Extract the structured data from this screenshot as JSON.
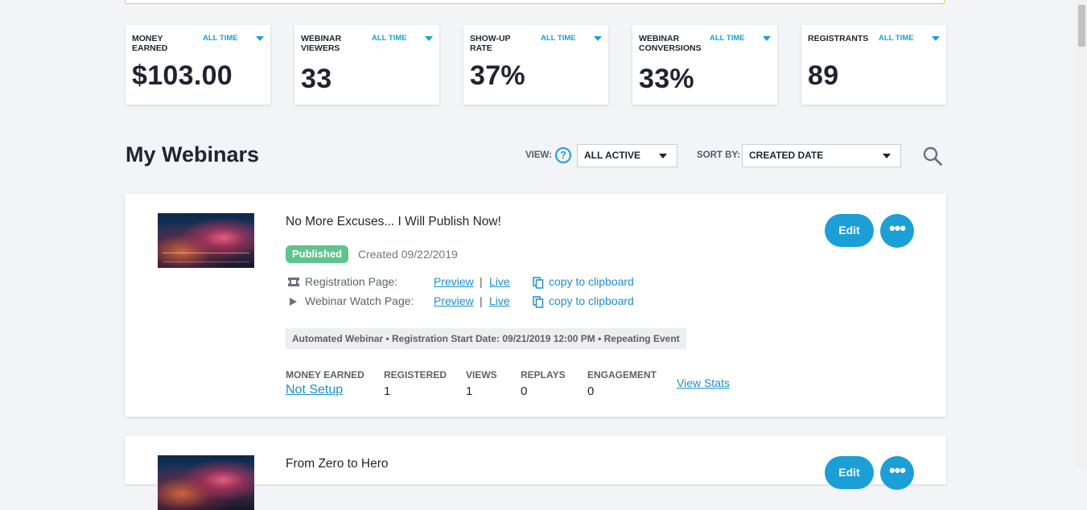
{
  "stats": [
    {
      "label": "MONEY EARNED",
      "range": "ALL TIME",
      "value": "$103.00"
    },
    {
      "label": "WEBINAR VIEWERS",
      "range": "ALL TIME",
      "value": "33"
    },
    {
      "label": "SHOW-UP RATE",
      "range": "ALL TIME",
      "value": "37%"
    },
    {
      "label": "WEBINAR CONVERSIONS",
      "range": "ALL TIME",
      "value": "33%"
    },
    {
      "label": "REGISTRANTS",
      "range": "ALL TIME",
      "value": "89"
    }
  ],
  "header": {
    "title": "My Webinars",
    "view_label": "VIEW:",
    "help_glyph": "?",
    "view_value": "ALL ACTIVE",
    "sort_label": "SORT BY:",
    "sort_value": "CREATED DATE"
  },
  "webinars": [
    {
      "title": "No More Excuses... I Will Publish Now!",
      "status": "Published",
      "created": "Created 09/22/2019",
      "registration_label": "Registration Page:",
      "watch_label": "Webinar Watch Page:",
      "preview": "Preview",
      "separator": "|",
      "live": "Live",
      "copy": "copy to clipboard",
      "meta": "Automated Webinar • Registration Start Date: 09/21/2019 12:00 PM • Repeating Event",
      "metrics": {
        "money_label": "MONEY EARNED",
        "money_value": "Not Setup",
        "registered_label": "REGISTERED",
        "registered_value": "1",
        "views_label": "VIEWS",
        "views_value": "1",
        "replays_label": "REPLAYS",
        "replays_value": "0",
        "engagement_label": "ENGAGEMENT",
        "engagement_value": "0"
      },
      "view_stats": "View Stats",
      "edit": "Edit",
      "more_glyph": "•••"
    },
    {
      "title": "From Zero to Hero",
      "edit": "Edit",
      "more_glyph": "•••"
    }
  ],
  "colors": {
    "accent": "#1c9fd6",
    "published": "#5fc48c",
    "banner_border": "#f2c94c"
  },
  "icons": [
    "ticket-icon",
    "play-icon",
    "copy-icon",
    "help-icon",
    "search-icon",
    "caret-down-icon"
  ]
}
